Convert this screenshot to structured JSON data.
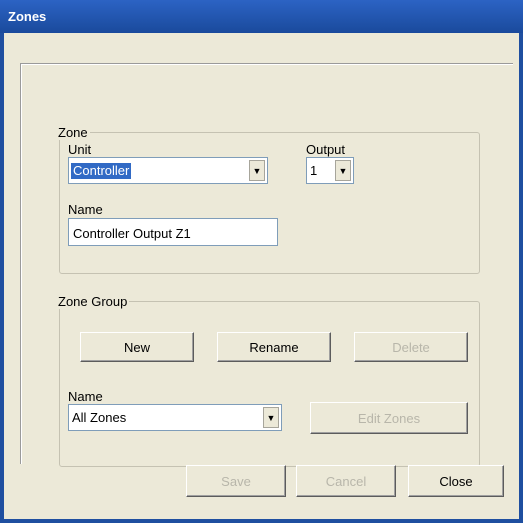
{
  "window": {
    "title": "Zones"
  },
  "zone": {
    "group_label": "Zone",
    "unit_label": "Unit",
    "unit_value": "Controller",
    "output_label": "Output",
    "output_value": "1",
    "name_label": "Name",
    "name_value": "Controller Output Z1"
  },
  "zone_group": {
    "group_label": "Zone Group",
    "new_label": "New",
    "rename_label": "Rename",
    "delete_label": "Delete",
    "name_label": "Name",
    "name_value": "All Zones",
    "edit_zones_label": "Edit Zones"
  },
  "footer": {
    "save_label": "Save",
    "cancel_label": "Cancel",
    "close_label": "Close"
  },
  "icons": {
    "dropdown": "chevron-down-icon"
  }
}
